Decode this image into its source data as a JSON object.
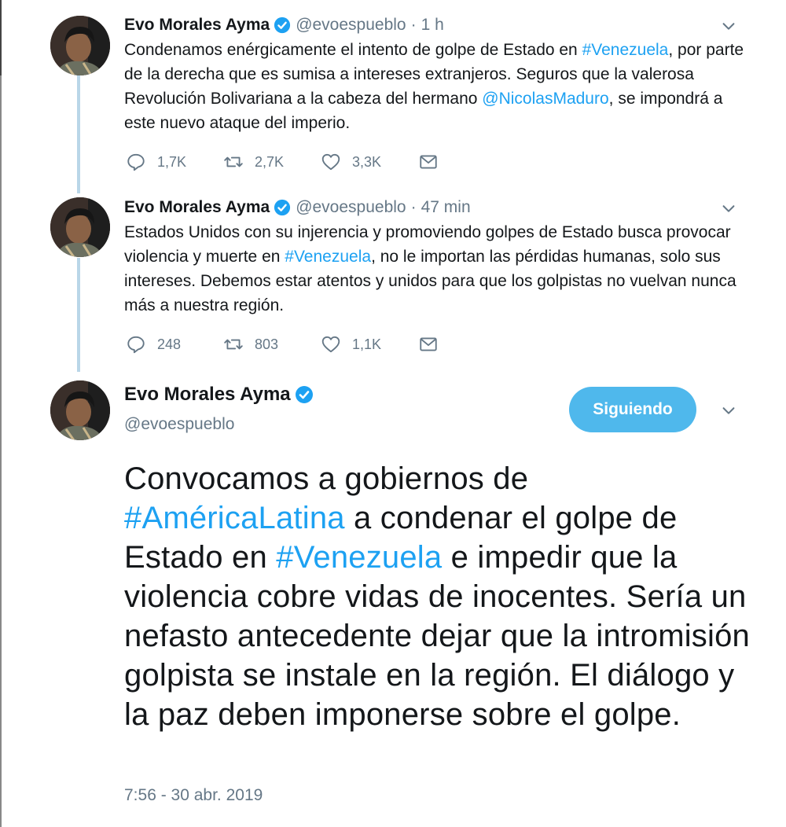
{
  "tweets": [
    {
      "name": "Evo Morales Ayma",
      "handle": "@evoespueblo",
      "time": "1 h",
      "text_segments": [
        {
          "t": "Condenamos enérgicamente el intento de golpe de Estado en ",
          "k": "plain"
        },
        {
          "t": "#Venezuela",
          "k": "hashtag"
        },
        {
          "t": ", por parte de la derecha que es sumisa a intereses extranjeros. Seguros que la valerosa Revolución Bolivariana a la cabeza del hermano ",
          "k": "plain"
        },
        {
          "t": "@NicolasMaduro",
          "k": "mention"
        },
        {
          "t": ", se impondrá a este nuevo ataque del imperio.",
          "k": "plain"
        }
      ],
      "replies": "1,7K",
      "retweets": "2,7K",
      "likes": "3,3K"
    },
    {
      "name": "Evo Morales Ayma",
      "handle": "@evoespueblo",
      "time": "47 min",
      "text_segments": [
        {
          "t": "Estados Unidos con su injerencia y promoviendo golpes de Estado  busca provocar violencia y muerte  en ",
          "k": "plain"
        },
        {
          "t": "#Venezuela",
          "k": "hashtag"
        },
        {
          "t": ", no le importan las pérdidas humanas, solo sus intereses. Debemos estar atentos y unidos para que los golpistas no vuelvan nunca más a nuestra región.",
          "k": "plain"
        }
      ],
      "replies": "248",
      "retweets": "803",
      "likes": "1,1K"
    }
  ],
  "main_tweet": {
    "name": "Evo Morales Ayma",
    "handle": "@evoespueblo",
    "follow_label": "Siguiendo",
    "text_segments": [
      {
        "t": "Convocamos a gobiernos de ",
        "k": "plain"
      },
      {
        "t": "#AméricaLatina",
        "k": "hashtag"
      },
      {
        "t": " a condenar el golpe de Estado en ",
        "k": "plain"
      },
      {
        "t": "#Venezuela",
        "k": "hashtag"
      },
      {
        "t": " e impedir que la violencia cobre vidas de inocentes. Sería un nefasto antecedente dejar que la intromisión golpista se instale en la región. El diálogo y la paz deben imponerse sobre el golpe.",
        "k": "plain"
      }
    ],
    "timestamp": "7:56 - 30 abr. 2019"
  },
  "colors": {
    "link": "#1da1f2",
    "follow_button": "#4fb8ec",
    "muted": "#657786",
    "thread_line": "#b9d6e8"
  },
  "icons": [
    "verified-badge-icon",
    "chevron-down-icon",
    "reply-icon",
    "retweet-icon",
    "like-icon",
    "message-icon"
  ]
}
